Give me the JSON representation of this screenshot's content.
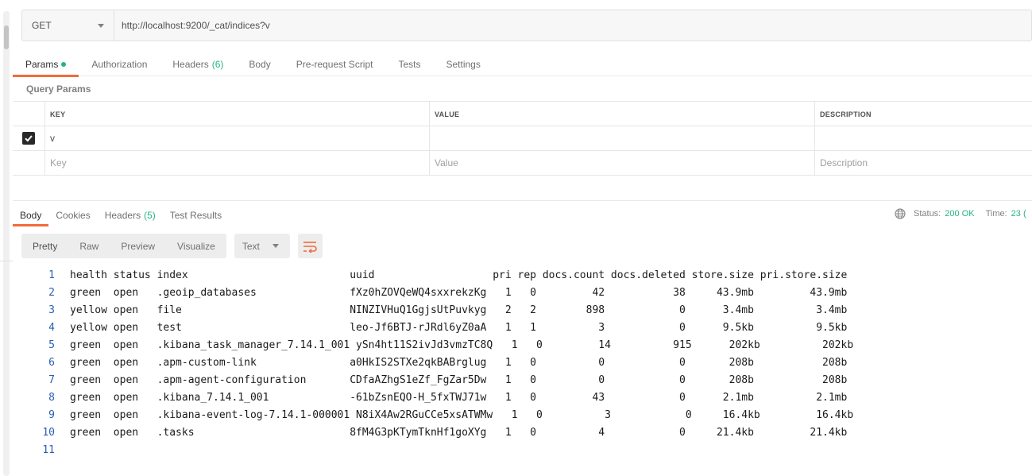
{
  "request": {
    "method": "GET",
    "url": "http://localhost:9200/_cat/indices?v"
  },
  "request_tabs": [
    {
      "label": "Params",
      "active": true
    },
    {
      "label": "Authorization"
    },
    {
      "label": "Headers",
      "count": "(6)"
    },
    {
      "label": "Body"
    },
    {
      "label": "Pre-request Script"
    },
    {
      "label": "Tests"
    },
    {
      "label": "Settings"
    }
  ],
  "query_params": {
    "label": "Query Params",
    "columns": {
      "key": "KEY",
      "value": "VALUE",
      "description": "DESCRIPTION"
    },
    "rows": [
      {
        "checked": true,
        "key": "v",
        "value": "",
        "description": ""
      }
    ],
    "placeholders": {
      "key": "Key",
      "value": "Value",
      "description": "Description"
    }
  },
  "response_tabs": [
    {
      "label": "Body",
      "active": true
    },
    {
      "label": "Cookies"
    },
    {
      "label": "Headers",
      "count": "(5)"
    },
    {
      "label": "Test Results"
    }
  ],
  "response_status": {
    "status_label": "Status:",
    "status_value": "200 OK",
    "time_label": "Time:",
    "time_value": "23 ("
  },
  "view_modes": [
    "Pretty",
    "Raw",
    "Preview",
    "Visualize"
  ],
  "format": "Text",
  "response_lines": [
    "health status index                          uuid                   pri rep docs.count docs.deleted store.size pri.store.size",
    "green  open   .geoip_databases               fXz0hZOVQeWQ4sxxrekzKg   1   0         42           38     43.9mb         43.9mb",
    "yellow open   file                           NINZIVHuQ1GgjsUtPuvkyg   2   2        898            0      3.4mb          3.4mb",
    "yellow open   test                           leo-Jf6BTJ-rJRdl6yZ0aA   1   1          3            0      9.5kb          9.5kb",
    "green  open   .kibana_task_manager_7.14.1_001 ySn4ht11S2ivJd3vmzTC8Q   1   0         14          915      202kb          202kb",
    "green  open   .apm-custom-link               a0HkIS2STXe2qkBABrglug   1   0          0            0       208b           208b",
    "green  open   .apm-agent-configuration       CDfaAZhgS1eZf_FgZar5Dw   1   0          0            0       208b           208b",
    "green  open   .kibana_7.14.1_001             -61bZsnEQO-H_5fxTWJ71w   1   0         43            0      2.1mb          2.1mb",
    "green  open   .kibana-event-log-7.14.1-000001 N8iX4Aw2RGuCCe5xsATWMw   1   0          3            0     16.4kb         16.4kb",
    "green  open   .tasks                         8fM4G3pKTymTknHf1goXYg   1   0          4            0     21.4kb         21.4kb",
    ""
  ]
}
